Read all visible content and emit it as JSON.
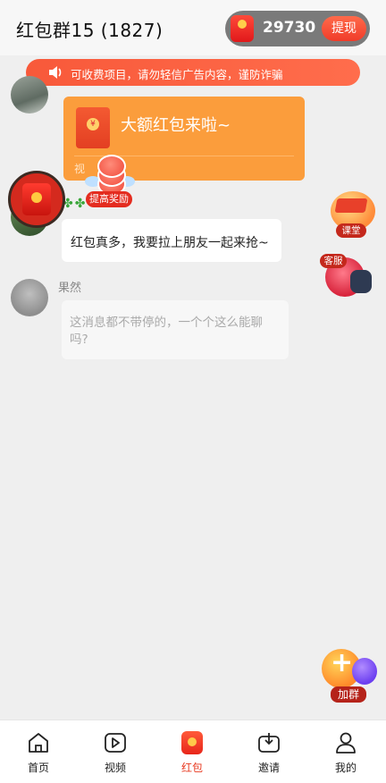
{
  "header": {
    "title": "红包群15 (1827)",
    "wallet_amount": "29730",
    "withdraw_label": "提现"
  },
  "notice": {
    "text": "可收费项目，请勿轻信广告内容，谨防诈骗"
  },
  "messages": [
    {
      "type": "red_packet",
      "text": "大额红包来啦~",
      "footer": "视"
    },
    {
      "type": "text",
      "text": "红包真多，我要拉上朋友一起来抢~"
    },
    {
      "type": "text",
      "sender": "果然",
      "text": "这消息都不带停的，一个个这么能聊吗?"
    }
  ],
  "floating": {
    "reward_tag": "提高奖励",
    "course_tag": "课堂",
    "service_tag": "客服",
    "join_tag": "加群"
  },
  "tabs": [
    {
      "label": "首页",
      "icon": "home-icon"
    },
    {
      "label": "视频",
      "icon": "video-icon"
    },
    {
      "label": "红包",
      "icon": "red-packet-icon",
      "active": true
    },
    {
      "label": "邀请",
      "icon": "invite-icon"
    },
    {
      "label": "我的",
      "icon": "profile-icon"
    }
  ],
  "colors": {
    "accent": "#e8381f",
    "notice_bg": "#f8593a",
    "red_packet_bubble": "#fb9d3c"
  }
}
